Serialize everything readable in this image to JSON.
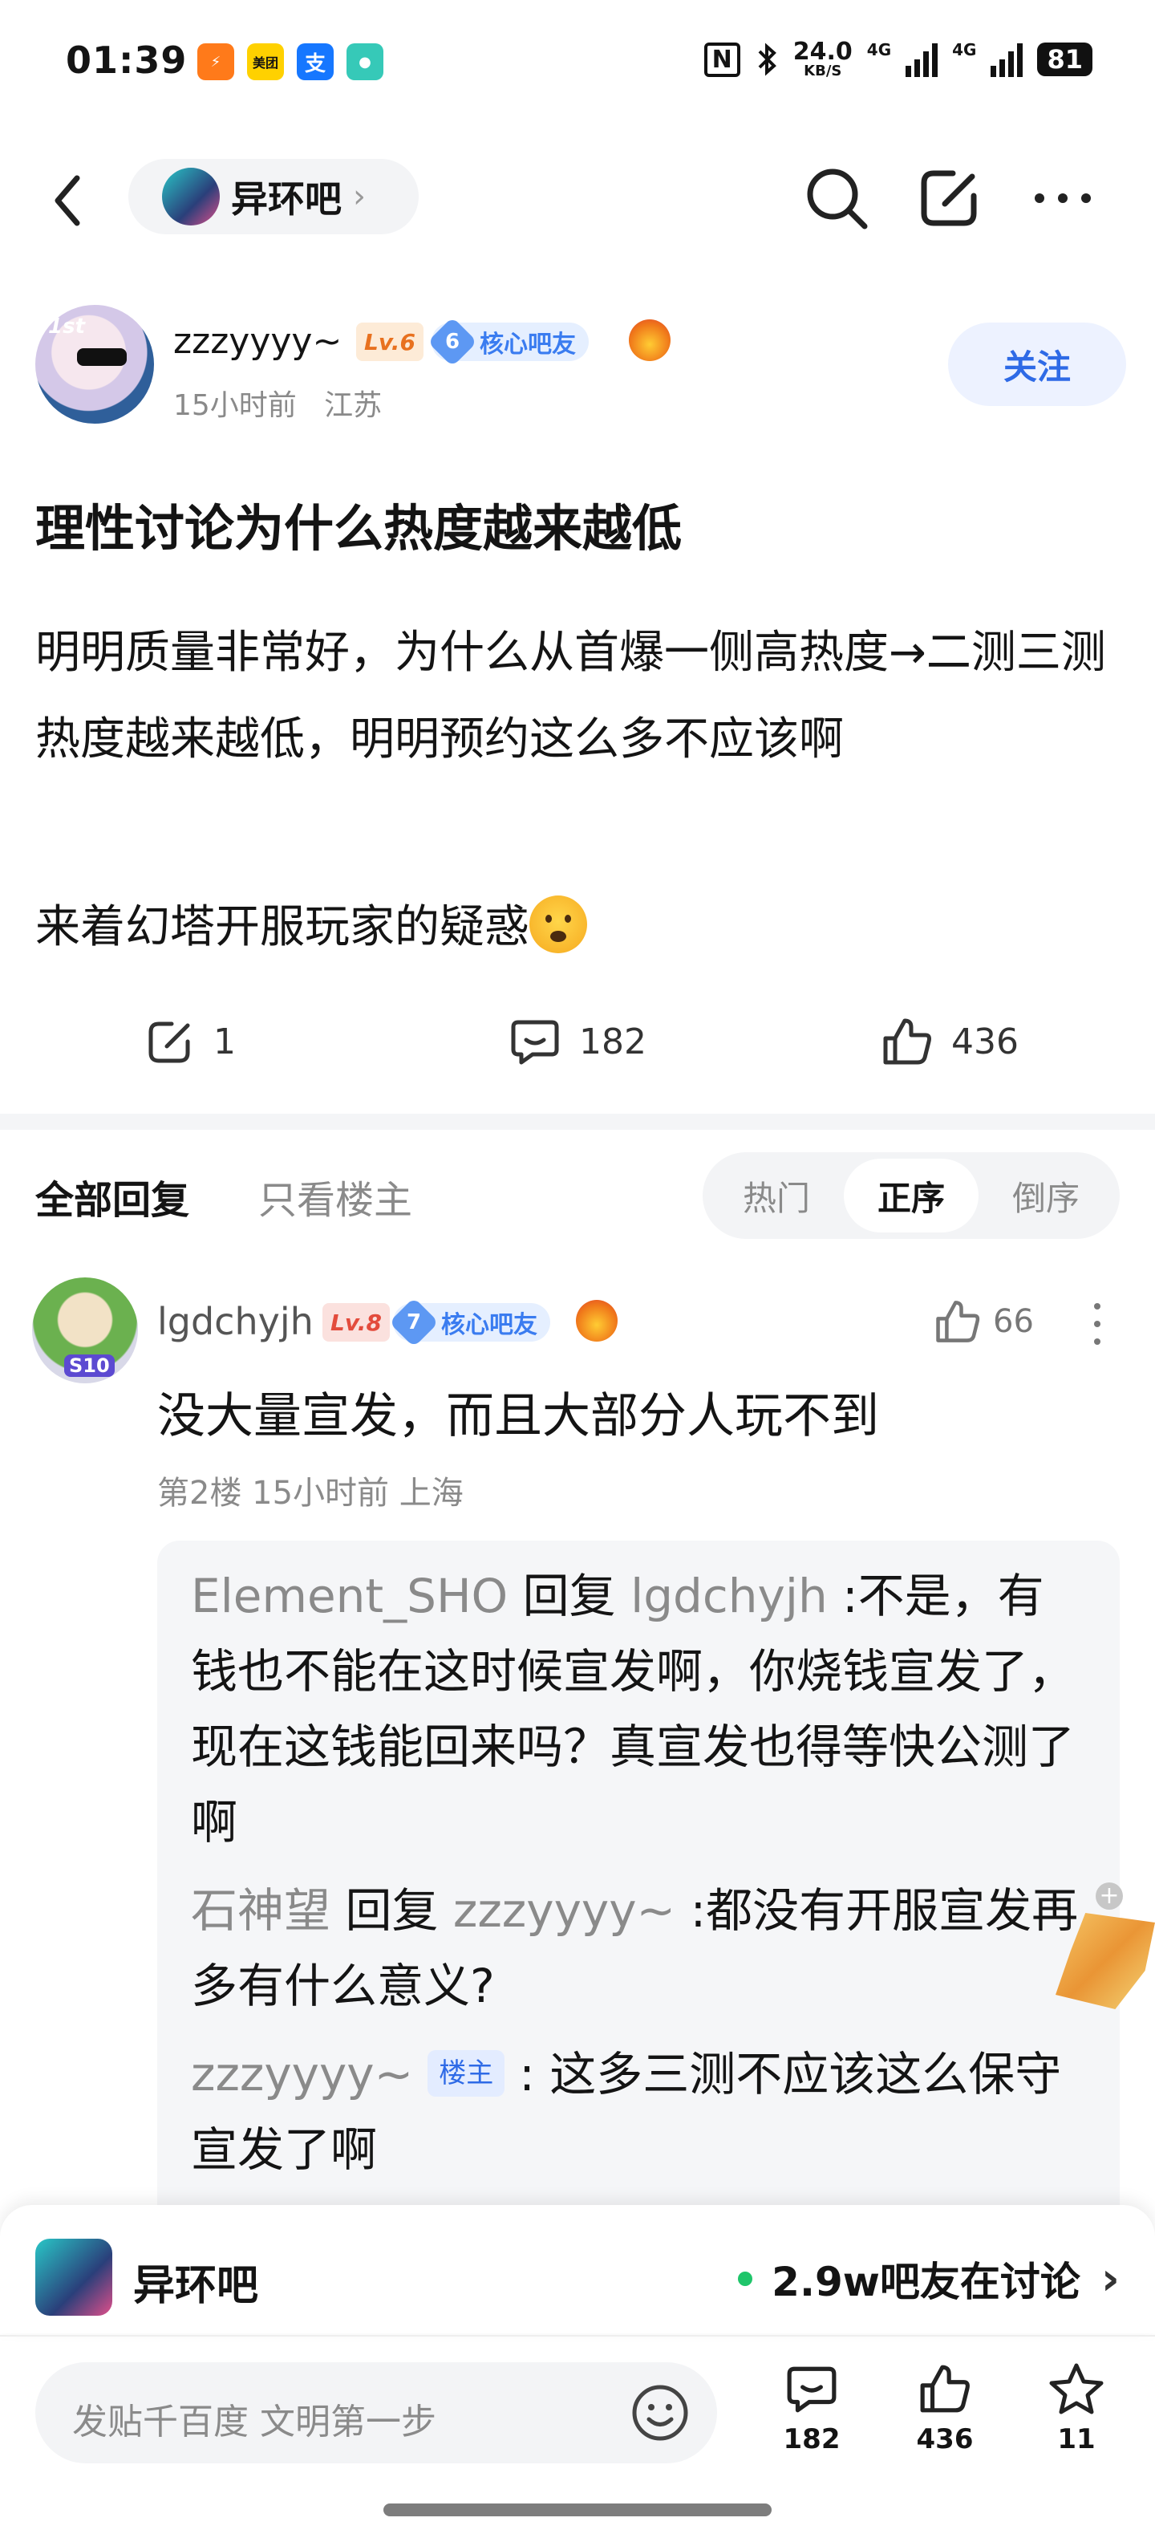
{
  "status_bar": {
    "time": "01:39",
    "apps": [
      {
        "name": "taobao-flash-app-icon",
        "glyph": "⚡",
        "color": "#ff7a1a"
      },
      {
        "name": "meituan-app-icon",
        "glyph": "美团",
        "color": "#ffd100"
      },
      {
        "name": "alipay-app-icon",
        "glyph": "支",
        "color": "#1677ff"
      },
      {
        "name": "chat-app-icon",
        "glyph": "●",
        "color": "#36c9b8"
      }
    ],
    "nfc": "N",
    "net_speed_value": "24.0",
    "net_speed_unit": "KB/S",
    "network_1": "4G",
    "network_2": "4G",
    "battery": "81"
  },
  "nav": {
    "forum_name": "异环吧"
  },
  "author": {
    "username": "zzzyyyy~",
    "avatar_tag": "1st",
    "level": "Lv.6",
    "core_level": "6",
    "core_label": "核心吧友",
    "time": "15小时前",
    "location": "江苏",
    "follow_label": "关注"
  },
  "post": {
    "title": "理性讨论为什么热度越来越低",
    "body": "明明质量非常好，为什么从首爆一侧高热度→二测三测热度越来越低，明明预约这么多不应该啊",
    "body2": "来着幻塔开服玩家的疑惑",
    "share_count": "1",
    "comment_count": "182",
    "like_count": "436"
  },
  "replies_header": {
    "tab_all": "全部回复",
    "tab_host_only": "只看楼主",
    "sort_hot": "热门",
    "sort_asc": "正序",
    "sort_desc": "倒序"
  },
  "reply": {
    "username": "lgdchyjh",
    "avatar_tag": "S10",
    "level": "Lv.8",
    "core_level": "7",
    "core_label": "核心吧友",
    "likes": "66",
    "text": "没大量宣发，而且大部分人玩不到",
    "meta": "第2楼 15小时前 上海",
    "sub_replies": [
      {
        "from": "Element_SHO",
        "reply_word": "回复",
        "to": "lgdchyjh",
        "text": ":不是，有钱也不能在这时候宣发啊，你烧钱宣发了，现在这钱能回来吗？真宣发也得等快公测了啊"
      },
      {
        "from": "石神望",
        "reply_word": "回复",
        "to": "zzzyyyy~",
        "text": ":都没有开服宣发再多有什么意义?"
      },
      {
        "from": "zzzyyyy~",
        "host_tag": "楼主",
        "text": ": 这多三测不应该这么保守宣发了啊"
      }
    ]
  },
  "forum_bar": {
    "name": "异环吧",
    "discussing": "2.9w吧友在讨论"
  },
  "composer": {
    "placeholder": "发贴千百度 文明第一步",
    "comment_count": "182",
    "like_count": "436",
    "star_count": "11"
  },
  "colors": {
    "accent": "#2e6ae6",
    "online": "#1fc56a",
    "muted": "#8a8a8a"
  }
}
